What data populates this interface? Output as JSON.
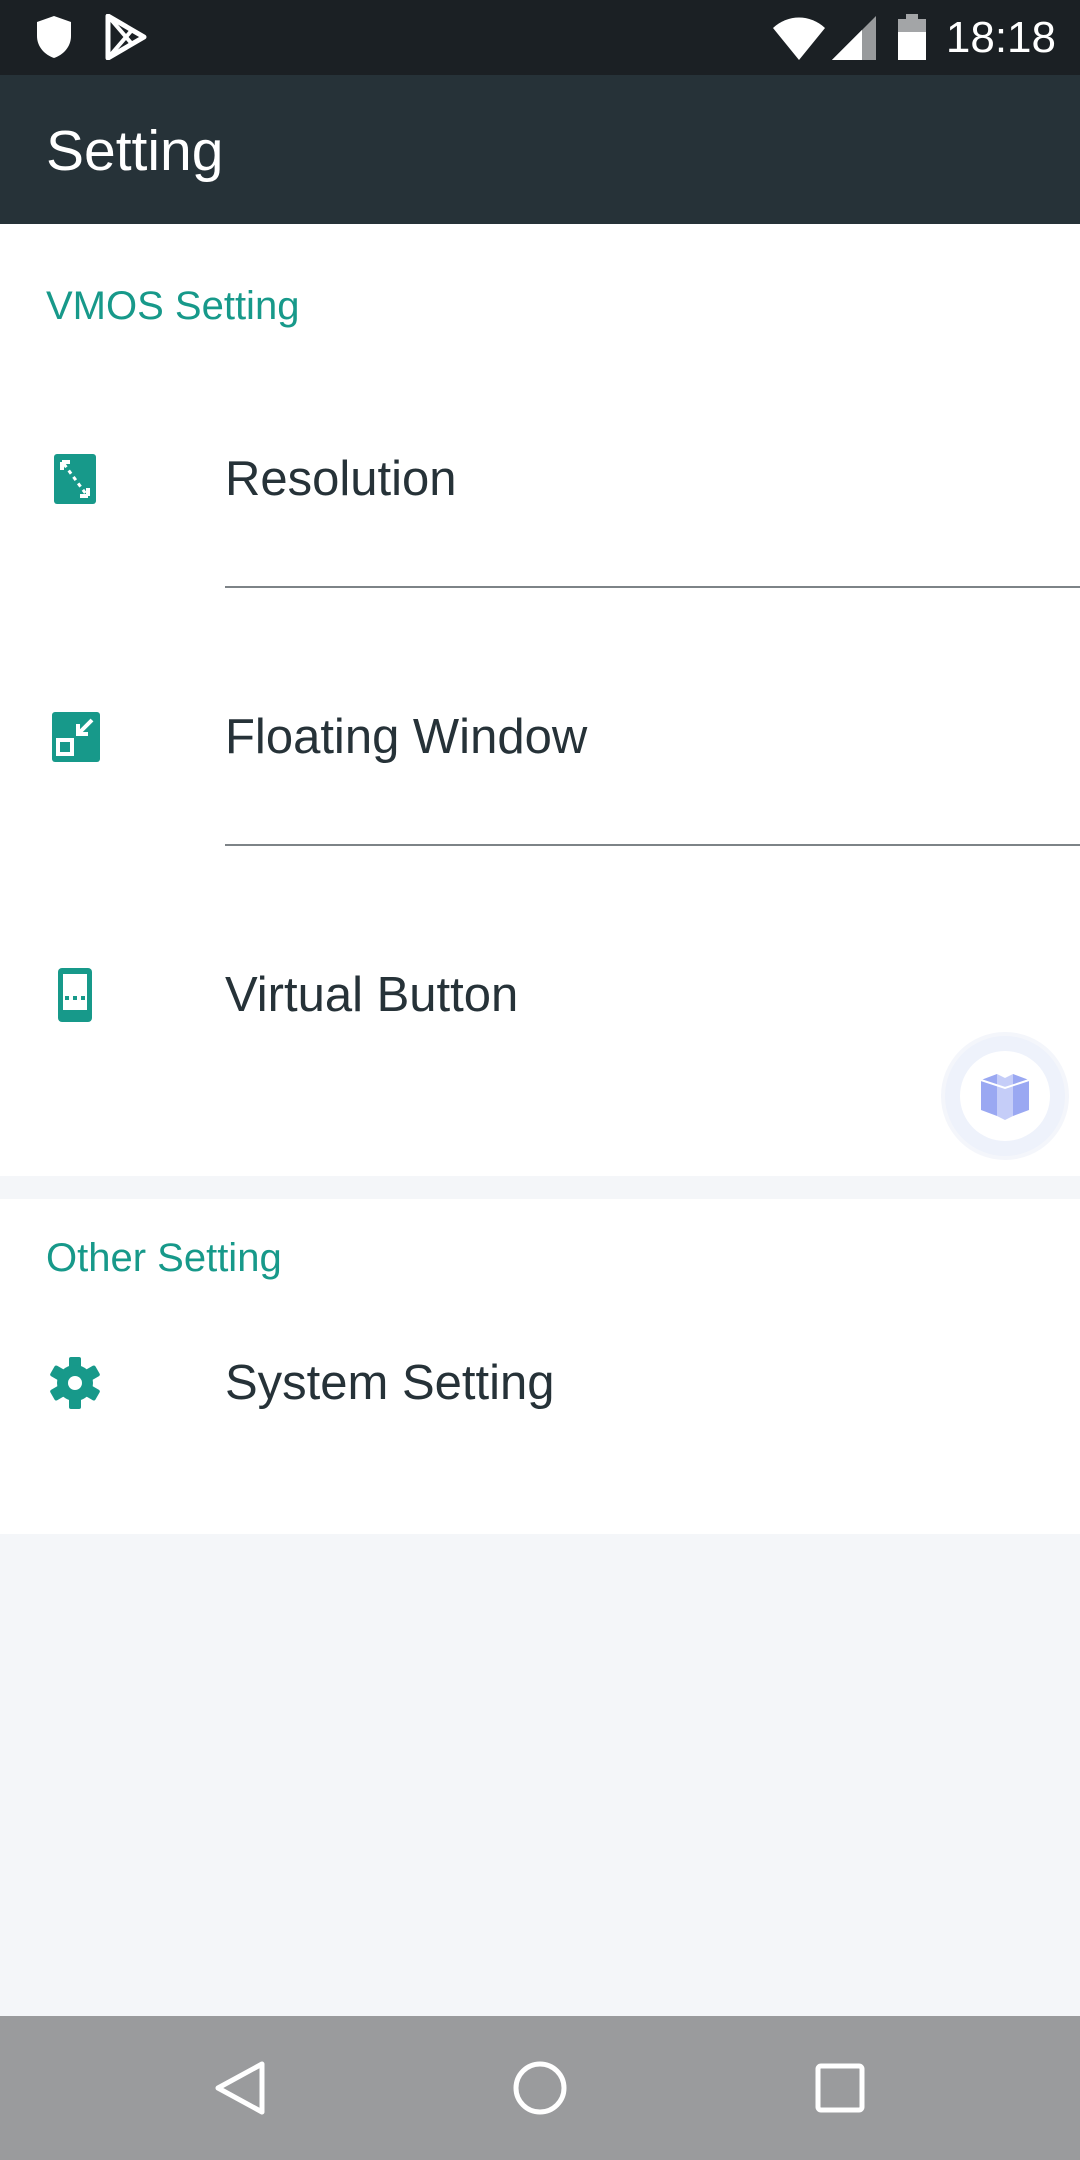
{
  "status_bar": {
    "time": "18:18",
    "icons": [
      "shield-icon",
      "play-store-icon",
      "wifi-icon",
      "cell-signal-icon",
      "battery-icon"
    ]
  },
  "app_bar": {
    "title": "Setting"
  },
  "sections": {
    "vmos": {
      "header": "VMOS Setting",
      "items": [
        {
          "label": "Resolution",
          "icon": "resolution-icon"
        },
        {
          "label": "Floating Window",
          "icon": "floating-window-icon"
        },
        {
          "label": "Virtual Button",
          "icon": "virtual-button-icon"
        }
      ]
    },
    "other": {
      "header": "Other Setting",
      "items": [
        {
          "label": "System Setting",
          "icon": "gear-icon"
        }
      ]
    }
  },
  "floating_button": {
    "icon": "vmos-cube-icon"
  },
  "nav_bar": {
    "icons": [
      "back-icon",
      "home-icon",
      "recents-icon"
    ]
  },
  "colors": {
    "accent": "#17998a",
    "app_bar": "#263238",
    "status_bar": "#1b2024",
    "background": "#f4f6f9",
    "nav_bar": "#9a9b9d",
    "text_primary": "#263238"
  }
}
